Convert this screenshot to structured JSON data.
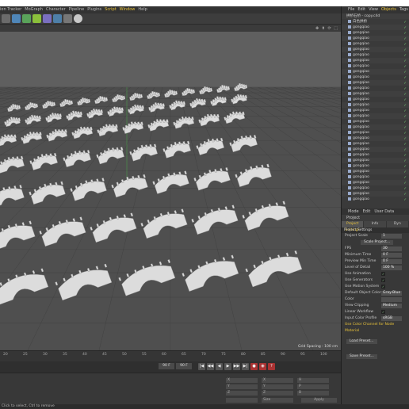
{
  "menubar": {
    "items": [
      {
        "label": "ion Tracker",
        "hl": false
      },
      {
        "label": "MoGraph",
        "hl": false
      },
      {
        "label": "Character",
        "hl": false
      },
      {
        "label": "Pipeline",
        "hl": false
      },
      {
        "label": "Plugins",
        "hl": false
      },
      {
        "label": "Script",
        "hl": true
      },
      {
        "label": "Window",
        "hl": true
      },
      {
        "label": "Help",
        "hl": false
      }
    ]
  },
  "toolbar": {
    "icons": [
      "cube-icon",
      "pen-icon",
      "subdivide-icon",
      "cloner-icon",
      "deformer-icon",
      "scene-icon",
      "camera-icon",
      "light-icon"
    ]
  },
  "viewport": {
    "nav_icons": "✥ ⬆ ⟳ ⬚",
    "info": "Grid Spacing : 100 cm",
    "colors": {
      "sky": "#5f5f5f",
      "floor": "#4f4f4f",
      "model": "#dcdcdc"
    }
  },
  "timeline": {
    "ticks": [
      "20",
      "25",
      "30",
      "35",
      "40",
      "45",
      "50",
      "55",
      "60",
      "65",
      "70",
      "75",
      "80",
      "85",
      "90",
      "95",
      "100"
    ]
  },
  "playbar": {
    "field_1": "90 F",
    "field_2": "90 F",
    "buttons": [
      "|◀",
      "◀◀",
      "◀",
      "▶",
      "▶▶",
      "▶|",
      "●",
      "◉",
      "?"
    ]
  },
  "attributes": {
    "apply_label": "Apply",
    "size_label": "Size",
    "scale_label": "Scale"
  },
  "status": "Click to select, Ctrl to remove",
  "objects_panel": {
    "menu": [
      {
        "label": "File",
        "hl": false
      },
      {
        "label": "Edit",
        "hl": false
      },
      {
        "label": "View",
        "hl": false
      },
      {
        "label": "Objects",
        "hl": true
      },
      {
        "label": "Tags",
        "hl": false
      },
      {
        "label": "Bo",
        "hl": false
      }
    ],
    "top_row": "拱桥石桥 - copy.c4d",
    "items": [
      "白色拱桥",
      "gongqiao",
      "gongqiao",
      "gongqiao",
      "gongqiao",
      "gongqiao",
      "gongqiao",
      "gongqiao",
      "gongqiao",
      "gongqiao",
      "gongqiao",
      "gongqiao",
      "gongqiao",
      "gongqiao",
      "gongqiao",
      "gongqiao",
      "gongqiao",
      "gongqiao",
      "gongqiao",
      "gongqiao",
      "gongqiao",
      "gongqiao",
      "gongqiao",
      "gongqiao",
      "gongqiao",
      "gongqiao",
      "gongqiao",
      "gongqiao",
      "gongqiao",
      "gongqiao",
      "gongqiao",
      "gongqiao",
      "gongqiao"
    ]
  },
  "attributes_panel": {
    "menu": [
      "Mode",
      "Edit",
      "User Data"
    ],
    "title": "Project",
    "tabs": [
      {
        "label": "Project Settings",
        "on": true
      },
      {
        "label": "Info",
        "on": false
      },
      {
        "label": "Dyn",
        "on": false
      }
    ],
    "section": "Project Settings",
    "rows": [
      {
        "label": "Project Scale",
        "value": "1",
        "kind": "value"
      },
      {
        "label": "",
        "value": "Scale Project...",
        "kind": "button"
      },
      {
        "label": "FPS",
        "value": "30",
        "kind": "value"
      },
      {
        "label": "Minimum Time",
        "value": "0 F",
        "kind": "value"
      },
      {
        "label": "Preview Min Time",
        "value": "0 F",
        "kind": "value"
      },
      {
        "label": "Level of Detail",
        "value": "100 %",
        "kind": "value"
      },
      {
        "label": "Use Animation",
        "value": "✓",
        "kind": "check"
      },
      {
        "label": "Use Generators",
        "value": "✓",
        "kind": "check"
      },
      {
        "label": "Use Motion System",
        "value": "✓",
        "kind": "check"
      },
      {
        "label": "Default Object Color",
        "value": "Gray-Blue",
        "kind": "value"
      },
      {
        "label": "Color",
        "value": "",
        "kind": "value"
      },
      {
        "label": "View Clipping",
        "value": "Medium",
        "kind": "value"
      },
      {
        "label": "Linear Workflow",
        "value": "✓",
        "kind": "check"
      },
      {
        "label": "Input Color Profile",
        "value": "sRGB",
        "kind": "value"
      },
      {
        "label": "Use Color Channel for Node Material",
        "value": "",
        "kind": "label"
      }
    ],
    "load_preset": "Load Preset...",
    "save_preset": "Save Preset..."
  }
}
